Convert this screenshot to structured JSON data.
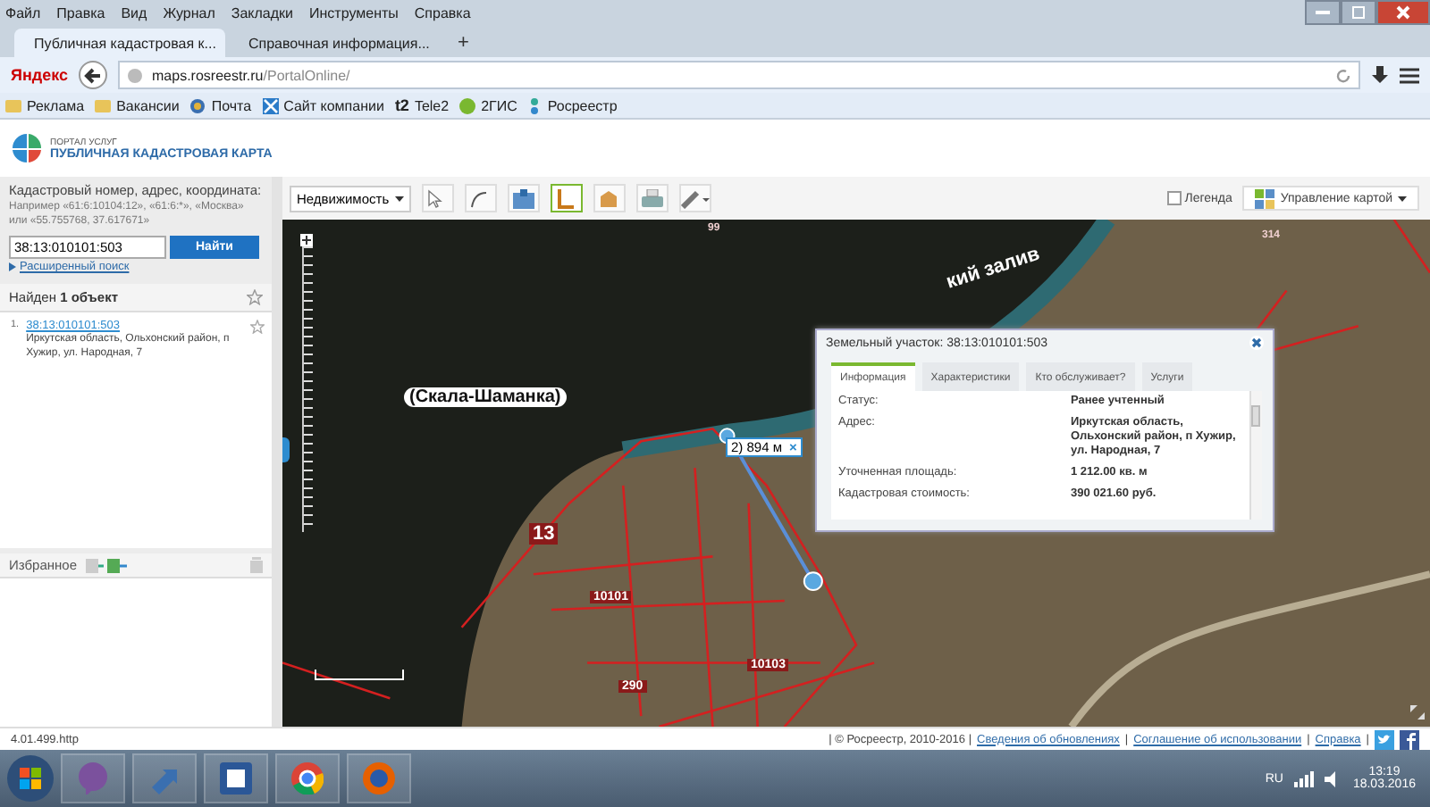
{
  "browser": {
    "menu": [
      "Файл",
      "Правка",
      "Вид",
      "Журнал",
      "Закладки",
      "Инструменты",
      "Справка"
    ],
    "tabs": [
      {
        "title": "Публичная кадастровая к...",
        "selected": true
      },
      {
        "title": "Справочная информация...",
        "selected": false
      }
    ],
    "new_tab": "+",
    "brand": "Яндекс",
    "url_host": "maps.rosreestr.ru",
    "url_path": "/PortalOnline/",
    "bookmarks": [
      {
        "label": "Реклама",
        "kind": "folder"
      },
      {
        "label": "Вакансии",
        "kind": "folder"
      },
      {
        "label": "Почта",
        "kind": "mail"
      },
      {
        "label": "Сайт компании",
        "kind": "site"
      },
      {
        "label": "Tele2",
        "kind": "tele2",
        "badge": "t2"
      },
      {
        "label": "2ГИС",
        "kind": "gis"
      },
      {
        "label": "Росреестр",
        "kind": "rosreestr"
      }
    ]
  },
  "portal": {
    "subtitle": "ПОРТАЛ УСЛУГ",
    "title": "ПУБЛИЧНАЯ КАДАСТРОВАЯ КАРТА"
  },
  "search": {
    "label": "Кадастровый номер, адрес, координата:",
    "hint": "Например «61:6:10104:12», «61:6:*», «Москва» или «55.755768, 37.617671»",
    "value": "38:13:010101:503",
    "button": "Найти",
    "advanced": "Расширенный поиск"
  },
  "results": {
    "heading": "Найден **1 объект**",
    "items": [
      {
        "number": "1.",
        "id": "38:13:010101:503",
        "address": "Иркутская область, Ольхонский район, п Хужир, ул. Народная, 7"
      }
    ]
  },
  "favorites": {
    "title": "Избранное"
  },
  "toolbar": {
    "layer": "Недвижимость",
    "tools": [
      {
        "kind": "identify",
        "selected": false
      },
      {
        "kind": "measure",
        "selected": false
      },
      {
        "kind": "info",
        "selected": false
      },
      {
        "kind": "parcel",
        "selected": true
      },
      {
        "kind": "building",
        "selected": false
      },
      {
        "kind": "print",
        "selected": false
      },
      {
        "kind": "ruler",
        "selected": false
      }
    ],
    "legend": {
      "label": "Легенда",
      "checked": false
    },
    "map_control": "Управление картой"
  },
  "map": {
    "labels": [
      {
        "text": "99",
        "kind": "small"
      },
      {
        "text": "кий залив",
        "kind": "water"
      },
      {
        "text": "314",
        "kind": "small"
      },
      {
        "text": "(Скала-Шаманка)",
        "kind": "place"
      },
      {
        "text": "13",
        "kind": "zone"
      },
      {
        "text": "10101",
        "kind": "block"
      },
      {
        "text": "10103",
        "kind": "block"
      },
      {
        "text": "290",
        "kind": "block"
      }
    ],
    "measure_label": "2) 894 м",
    "measure_close": "×"
  },
  "popup": {
    "title": "Земельный участок: 38:13:010101:503",
    "tabs": [
      {
        "label": "Информация",
        "selected": true
      },
      {
        "label": "Характеристики",
        "selected": false
      },
      {
        "label": "Кто обслуживает?",
        "selected": false
      },
      {
        "label": "Услуги",
        "selected": false
      }
    ],
    "rows": [
      {
        "name": "Статус:",
        "value": "Ранее учтенный"
      },
      {
        "name": "Адрес:",
        "value": "Иркутская область, Ольхонский район, п Хужир, ул. Народная, 7"
      },
      {
        "name": "Уточненная площадь:",
        "value": "1 212.00 кв. м"
      },
      {
        "name": "Кадастровая стоимость:",
        "value": "390 021.60 руб."
      }
    ]
  },
  "footer": {
    "version": "4.01.499.http",
    "copyright": "| © Росреестр, 2010-2016 |",
    "separator": "|",
    "links": [
      "Сведения об обновлениях",
      "Соглашение об использовании",
      "Справка"
    ]
  },
  "taskbar": {
    "apps": [
      {
        "kind": "viber"
      },
      {
        "kind": "arrow"
      },
      {
        "kind": "word"
      },
      {
        "kind": "chrome"
      },
      {
        "kind": "firefox"
      }
    ],
    "language": "RU",
    "time": "13:19",
    "date": "18.03.2016"
  }
}
